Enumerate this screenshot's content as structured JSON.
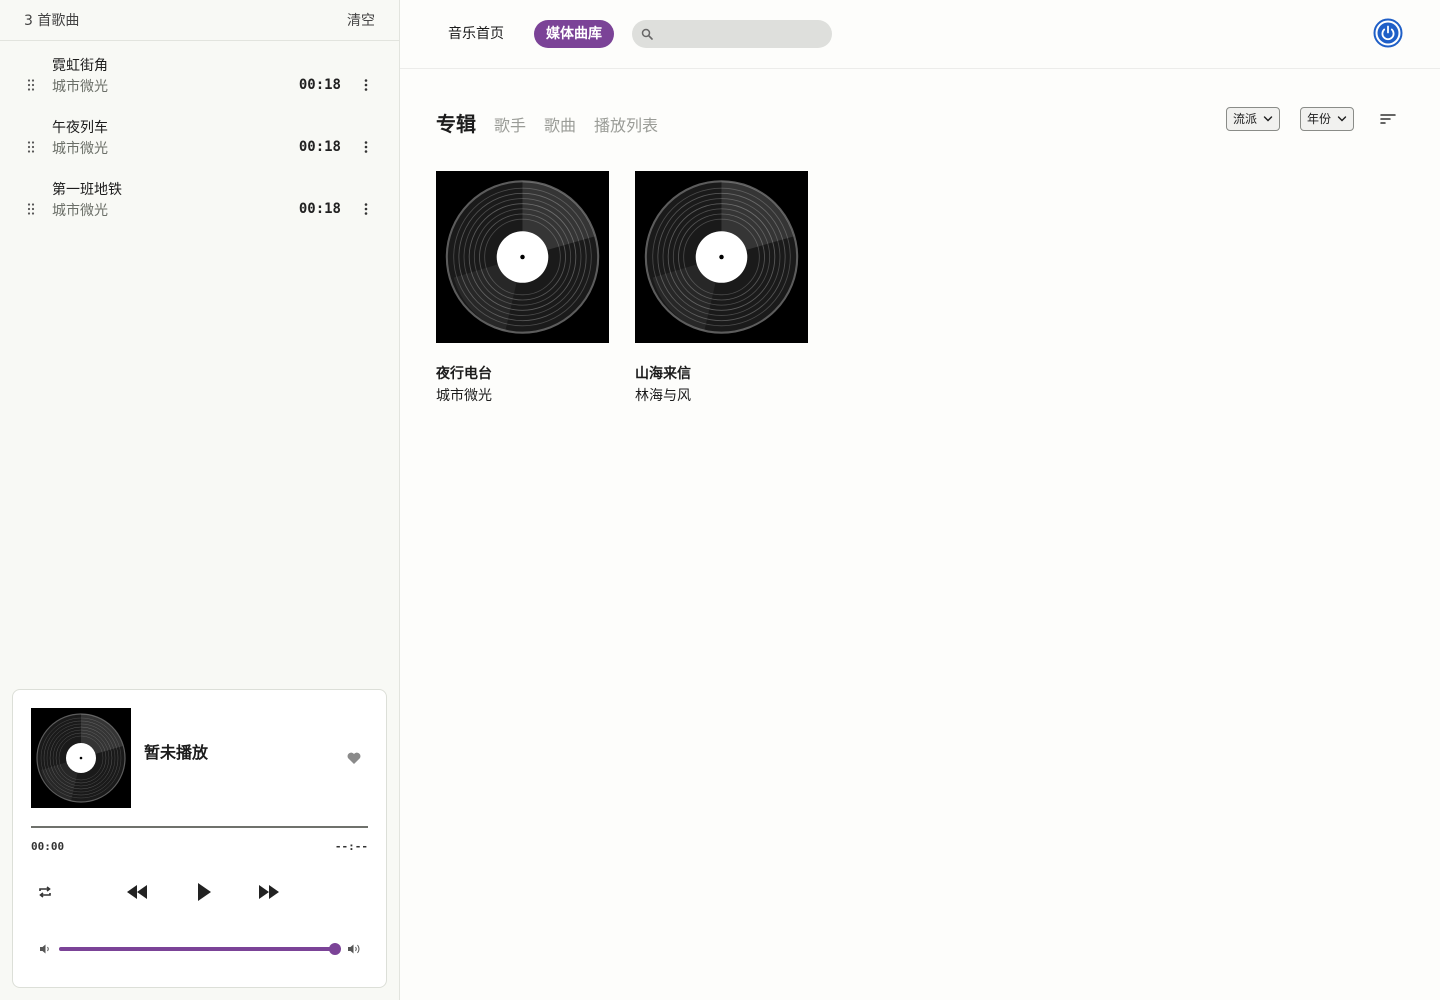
{
  "queue": {
    "count_label": "3 首歌曲",
    "clear_label": "清空",
    "items": [
      {
        "title": "霓虹街角",
        "artist": "城市微光",
        "duration": "00:18"
      },
      {
        "title": "午夜列车",
        "artist": "城市微光",
        "duration": "00:18"
      },
      {
        "title": "第一班地铁",
        "artist": "城市微光",
        "duration": "00:18"
      }
    ]
  },
  "player": {
    "title": "暂未播放",
    "time_current": "00:00",
    "time_total": "--:--",
    "progress": 0,
    "volume": 1.0
  },
  "nav": {
    "home": "音乐首页",
    "library": "媒体曲库",
    "search_value": ""
  },
  "library": {
    "tabs": [
      {
        "label": "专辑",
        "active": true
      },
      {
        "label": "歌手",
        "active": false
      },
      {
        "label": "歌曲",
        "active": false
      },
      {
        "label": "播放列表",
        "active": false
      }
    ],
    "filters": {
      "genre": "流派",
      "year": "年份"
    },
    "albums": [
      {
        "title": "夜行电台",
        "artist": "城市微光"
      },
      {
        "title": "山海来信",
        "artist": "林海与风"
      }
    ]
  },
  "colors": {
    "accent": "#7b4397",
    "power_ring": "#1f5fc7",
    "sidebar_bg": "#f8f9f5"
  },
  "icons": {
    "drag": "drag-handle-icon",
    "more": "more-vertical-icon",
    "heart": "heart-icon",
    "repeat": "repeat-icon",
    "rewind": "rewind-icon",
    "play": "play-icon",
    "forward": "fast-forward-icon",
    "volume_low": "volume-low-icon",
    "volume_high": "volume-high-icon",
    "search": "search-icon",
    "power": "power-icon",
    "chevron": "chevron-down-icon",
    "sort": "sort-icon"
  }
}
